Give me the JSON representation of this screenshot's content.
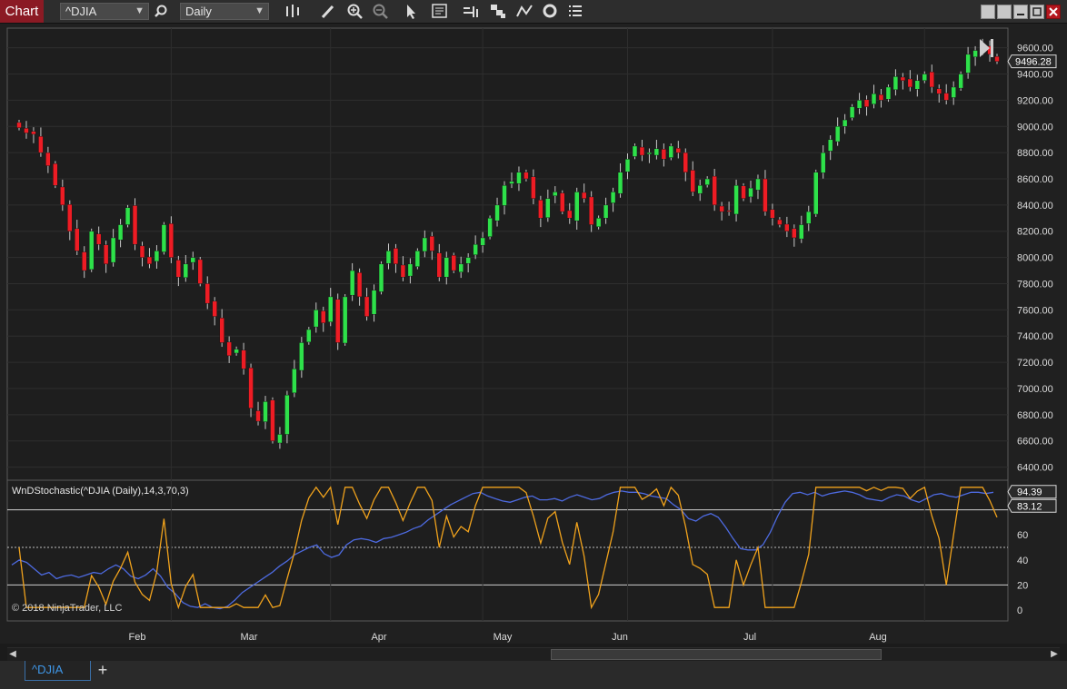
{
  "toolbar": {
    "title": "Chart",
    "instrument": "^DJIA",
    "interval": "Daily",
    "icons": [
      "search-icon",
      "bar-type-icon",
      "draw-pencil-icon",
      "zoom-in-icon",
      "zoom-out-icon",
      "pointer-icon",
      "data-box-icon",
      "bar-spacing-icon",
      "chart-style-icon",
      "indicators-icon",
      "refresh-icon",
      "properties-icon"
    ],
    "window_icons": [
      "window-tile-icon",
      "window-tile2-icon",
      "minimize-icon",
      "maximize-icon",
      "close-icon"
    ]
  },
  "price_panel": {
    "y_ticks": [
      "9600.00",
      "9400.00",
      "9200.00",
      "9000.00",
      "8800.00",
      "8600.00",
      "8400.00",
      "8200.00",
      "8000.00",
      "7800.00",
      "7600.00",
      "7400.00",
      "7200.00",
      "7000.00",
      "6800.00",
      "6600.00",
      "6400.00"
    ],
    "last_price": "9496.28"
  },
  "indicator_panel": {
    "label": "WnDStochastic(^DJIA (Daily),14,3,70,3)",
    "k_value": "94.39",
    "d_value": "83.12",
    "y_ticks": [
      "60",
      "40",
      "20",
      "0"
    ],
    "copyright": "© 2018 NinjaTrader, LLC"
  },
  "x_axis": {
    "labels": [
      "Feb",
      "Mar",
      "Apr",
      "May",
      "Jun",
      "Jul",
      "Aug"
    ]
  },
  "tabs": [
    {
      "label": "^DJIA"
    }
  ],
  "add_tab_label": "+",
  "colors": {
    "up": "#2ee14a",
    "down": "#ee1c24",
    "wick": "#c8c8c8",
    "k_line": "#4d6ae0",
    "d_line": "#f0a21c",
    "accent": "#8b1a24"
  },
  "chart_data": {
    "type": "candlestick",
    "price_range": [
      6300,
      9750
    ],
    "closes": [
      8990,
      8950,
      8940,
      8800,
      8700,
      8550,
      8400,
      8200,
      8050,
      7900,
      8200,
      8100,
      7950,
      8150,
      8250,
      8380,
      8100,
      8000,
      7950,
      8050,
      8250,
      8000,
      7850,
      7950,
      8000,
      7800,
      7650,
      7550,
      7350,
      7250,
      7300,
      7150,
      6850,
      6750,
      6900,
      6600,
      6650,
      6950,
      7150,
      7350,
      7450,
      7600,
      7500,
      7700,
      7350,
      7700,
      7900,
      7700,
      7550,
      7750,
      7950,
      8050,
      7950,
      7850,
      7950,
      8050,
      8150,
      8050,
      7850,
      8000,
      7900,
      7950,
      8000,
      8100,
      8150,
      8300,
      8400,
      8550,
      8580,
      8650,
      8600,
      8450,
      8300,
      8450,
      8500,
      8350,
      8300,
      8500,
      8450,
      8250,
      8300,
      8400,
      8500,
      8650,
      8750,
      8850,
      8780,
      8800,
      8830,
      8750,
      8850,
      8800,
      8650,
      8500,
      8550,
      8600,
      8400,
      8350,
      8350,
      8550,
      8450,
      8530,
      8600,
      8350,
      8300,
      8250,
      8200,
      8150,
      8250,
      8350,
      8650,
      8800,
      8900,
      9000,
      9050,
      9150,
      9200,
      9150,
      9250,
      9200,
      9300,
      9380,
      9350,
      9300,
      9350,
      9400,
      9300,
      9250,
      9200,
      9300,
      9400,
      9550,
      9580,
      9600,
      9550,
      9496
    ],
    "stochastic": {
      "y_range": [
        0,
        100
      ],
      "overbought": 80,
      "oversold": 20,
      "midline": 50,
      "k": [
        36,
        40,
        38,
        33,
        28,
        30,
        25,
        27,
        28,
        26,
        28,
        30,
        29,
        33,
        36,
        33,
        27,
        25,
        28,
        33,
        27,
        18,
        13,
        6,
        3,
        2,
        5,
        2,
        1,
        3,
        8,
        14,
        18,
        22,
        26,
        30,
        35,
        39,
        44,
        47,
        50,
        52,
        45,
        42,
        44,
        52,
        56,
        57,
        56,
        54,
        57,
        58,
        60,
        62,
        65,
        67,
        72,
        76,
        80,
        84,
        87,
        90,
        93,
        94,
        91,
        89,
        87,
        86,
        88,
        90,
        91,
        88,
        88,
        89,
        87,
        90,
        92,
        90,
        88,
        89,
        92,
        94,
        95,
        94,
        94,
        93,
        91,
        90,
        89,
        84,
        80,
        73,
        71,
        75,
        77,
        74,
        66,
        57,
        49,
        48,
        48,
        52,
        62,
        75,
        86,
        93,
        94,
        92,
        94,
        91,
        93,
        94,
        95,
        94,
        92,
        89,
        88,
        87,
        90,
        92,
        91,
        88,
        86,
        89,
        92,
        93,
        91,
        90,
        92,
        94,
        94,
        93,
        94
      ]
    }
  }
}
